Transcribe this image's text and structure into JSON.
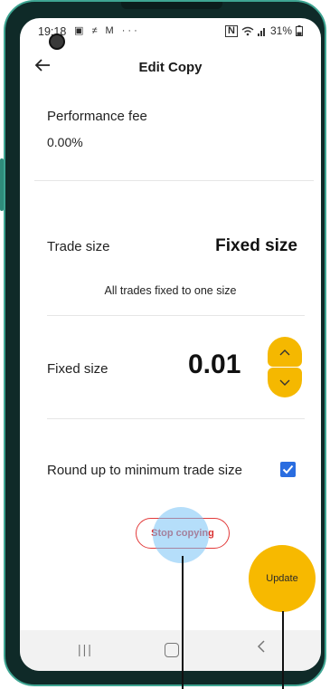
{
  "status_bar": {
    "time": "19:18",
    "left_icons": "▣ ≠ M ···",
    "nfc": "N",
    "battery": "31%"
  },
  "header": {
    "title": "Edit Copy"
  },
  "performance_fee": {
    "label": "Performance fee",
    "value": "0.00%"
  },
  "trade_size": {
    "label": "Trade size",
    "value": "Fixed size",
    "description": "All trades fixed to one size"
  },
  "fixed_size": {
    "label": "Fixed size",
    "value": "0.01"
  },
  "round_up": {
    "label": "Round up to minimum trade size",
    "checked": true
  },
  "actions": {
    "stop_label": "Stop copying",
    "update_label": "Update"
  },
  "colors": {
    "accent": "#f5b800",
    "danger": "#e23a3a",
    "checkbox": "#2a6de0"
  }
}
